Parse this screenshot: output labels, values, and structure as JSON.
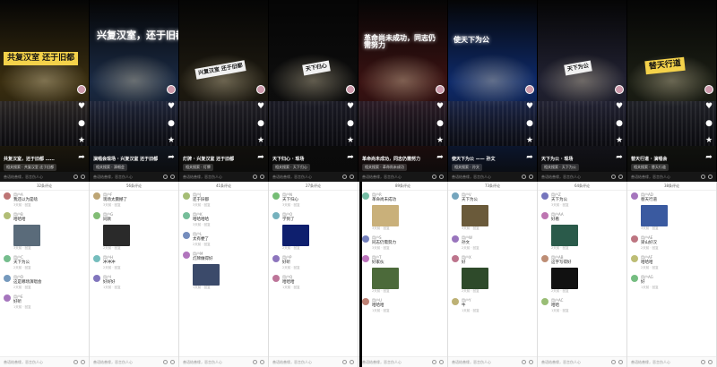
{
  "videos": [
    {
      "banner": "共复汉室 还于旧都",
      "caption": "共复汉室，还于旧都 ……",
      "related": "相关搜索 · 共复汉室 还于旧都",
      "comment_placeholder": "善语结善缘，恶言伤人心",
      "scene": "#3a2e10"
    },
    {
      "banner": "兴复汉室，还于旧都",
      "caption": "演唱会现场 · 兴复汉室 还于旧都",
      "related": "相关搜索 · 演唱会",
      "comment_placeholder": "善语结善缘，恶言伤人心",
      "scene": "#1a2a44"
    },
    {
      "banner": "兴复汉室 还于旧都",
      "caption": "灯牌 · 兴复汉室 还于旧都",
      "related": "相关搜索 · 灯牌",
      "comment_placeholder": "善语结善缘，恶言伤人心",
      "scene": "#1e1a10"
    },
    {
      "banner": "天下归心",
      "caption": "天下归心 · 现场",
      "related": "相关搜索 · 天下归心",
      "comment_placeholder": "善语结善缘，恶言伤人心",
      "scene": "#0d0d0d"
    },
    {
      "banner": "革命尚未成功，同志仍需努力",
      "caption": "革命尚未成功，同志仍需努力",
      "related": "相关搜索 · 革命尚未成功",
      "comment_placeholder": "善语结善缘，恶言伤人心",
      "scene": "#3a1212"
    },
    {
      "banner": "使天下为公",
      "caption": "使天下为公 —— 孙文",
      "related": "相关搜索 · 孙文",
      "comment_placeholder": "善语结善缘，恶言伤人心",
      "scene": "#0e2a6a"
    },
    {
      "banner": "天下为公",
      "caption": "天下为公 · 现场",
      "related": "相关搜索 · 天下为公",
      "comment_placeholder": "善语结善缘，恶言伤人心",
      "scene": "#222233"
    },
    {
      "banner": "替天行道",
      "caption": "替天行道 · 演唱会",
      "related": "相关搜索 · 替天行道",
      "comment_placeholder": "善语结善缘，恶言伤人心",
      "scene": "#1b1e14"
    }
  ],
  "comments": [
    {
      "header": "32条评论",
      "items": [
        {
          "name": "用户A",
          "text": "我还以为是啥",
          "meta": "3天前 · 回复"
        },
        {
          "name": "用户B",
          "text": "哈哈哈",
          "meta": "3天前 · 回复",
          "thumb": "#5a6b7a"
        },
        {
          "name": "用户C",
          "text": "天下为公",
          "meta": "2天前 · 回复"
        },
        {
          "name": "用户D",
          "text": "这是哪场演唱会",
          "meta": "2天前 · 回复"
        },
        {
          "name": "用户E",
          "text": "好听",
          "meta": "1天前 · 回复"
        }
      ],
      "placeholder": "善语结善缘，恶言伤人心"
    },
    {
      "header": "56条评论",
      "items": [
        {
          "name": "用户F",
          "text": "现场太震撼了",
          "meta": "3天前 · 回复"
        },
        {
          "name": "用户G",
          "text": "同款",
          "meta": "2天前 · 回复",
          "thumb": "#2a2a2a"
        },
        {
          "name": "用户H",
          "text": "冲冲冲",
          "meta": "2天前 · 回复"
        },
        {
          "name": "用户I",
          "text": "好好好",
          "meta": "1天前 · 回复"
        }
      ],
      "placeholder": "善语结善缘，恶言伤人心"
    },
    {
      "header": "41条评论",
      "items": [
        {
          "name": "用户J",
          "text": "还于旧都",
          "meta": "3天前 · 回复"
        },
        {
          "name": "用户K",
          "text": "哈哈哈哈",
          "meta": "3天前 · 回复"
        },
        {
          "name": "用户L",
          "text": "太有梗了",
          "meta": "2天前 · 回复"
        },
        {
          "name": "用户M",
          "text": "灯牌做得好",
          "meta": "1天前 · 回复",
          "thumb": "#3b4a6a"
        }
      ],
      "placeholder": "善语结善缘，恶言伤人心"
    },
    {
      "header": "27条评论",
      "items": [
        {
          "name": "用户N",
          "text": "天下归心",
          "meta": "3天前 · 回复"
        },
        {
          "name": "用户O",
          "text": "学到了",
          "meta": "2天前 · 回复",
          "thumb": "#0e1f6e"
        },
        {
          "name": "用户P",
          "text": "好听",
          "meta": "2天前 · 回复"
        },
        {
          "name": "用户Q",
          "text": "哈哈哈",
          "meta": "1天前 · 回复"
        }
      ],
      "placeholder": "善语结善缘，恶言伤人心"
    },
    {
      "header": "89条评论",
      "items": [
        {
          "name": "用户R",
          "text": "革命尚未成功",
          "meta": "3天前 · 回复",
          "thumb": "#c9b07a"
        },
        {
          "name": "用户S",
          "text": "同志仍需努力",
          "meta": "3天前 · 回复"
        },
        {
          "name": "用户T",
          "text": "好家伙",
          "meta": "2天前 · 回复",
          "thumb": "#4c6a3a"
        },
        {
          "name": "用户U",
          "text": "哈哈哈",
          "meta": "1天前 · 回复"
        }
      ],
      "placeholder": "善语结善缘，恶言伤人心"
    },
    {
      "header": "73条评论",
      "items": [
        {
          "name": "用户V",
          "text": "天下为公",
          "meta": "3天前 · 回复",
          "thumb": "#6a5a3a"
        },
        {
          "name": "用户W",
          "text": "孙文",
          "meta": "2天前 · 回复"
        },
        {
          "name": "用户X",
          "text": "好",
          "meta": "2天前 · 回复",
          "thumb": "#2e4a2a"
        },
        {
          "name": "用户Y",
          "text": "牛",
          "meta": "1天前 · 回复"
        }
      ],
      "placeholder": "善语结善缘，恶言伤人心"
    },
    {
      "header": "64条评论",
      "items": [
        {
          "name": "用户Z",
          "text": "天下为公",
          "meta": "3天前 · 回复"
        },
        {
          "name": "用户AA",
          "text": "好看",
          "meta": "2天前 · 回复",
          "thumb": "#2a5a4a"
        },
        {
          "name": "用户AB",
          "text": "这字写得好",
          "meta": "2天前 · 回复",
          "thumb": "#111111"
        },
        {
          "name": "用户AC",
          "text": "哈哈",
          "meta": "1天前 · 回复"
        }
      ],
      "placeholder": "善语结善缘，恶言伤人心"
    },
    {
      "header": "38条评论",
      "items": [
        {
          "name": "用户AD",
          "text": "替天行道",
          "meta": "3天前 · 回复",
          "thumb": "#3a5aa0"
        },
        {
          "name": "用户AE",
          "text": "梁山好汉",
          "meta": "2天前 · 回复"
        },
        {
          "name": "用户AF",
          "text": "哈哈哈",
          "meta": "2天前 · 回复"
        },
        {
          "name": "用户AG",
          "text": "好",
          "meta": "1天前 · 回复"
        }
      ],
      "placeholder": "善语结善缘，恶言伤人心"
    }
  ]
}
